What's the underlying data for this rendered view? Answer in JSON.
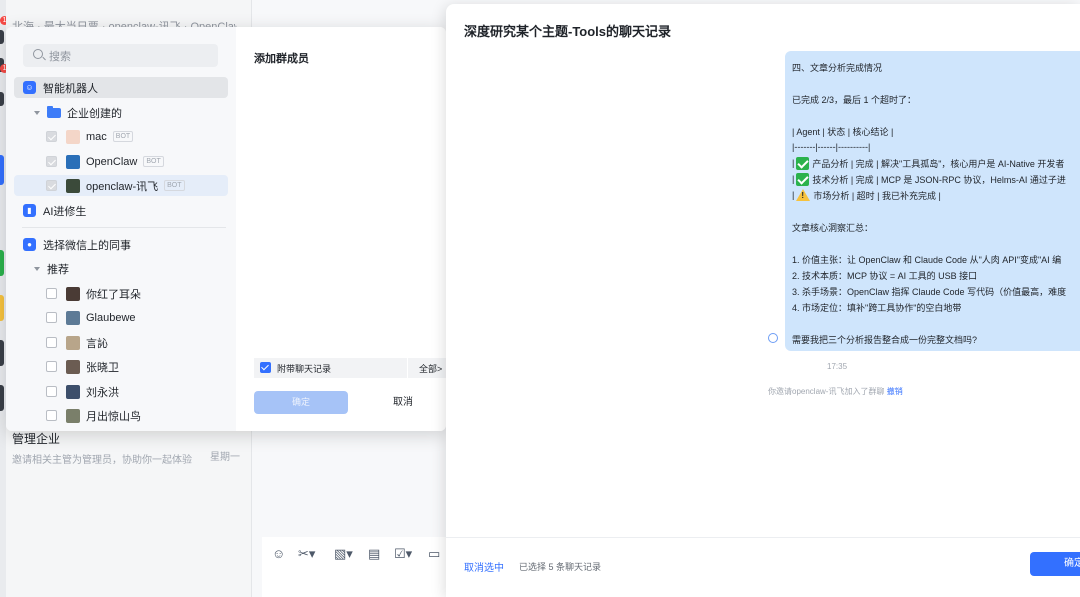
{
  "background": {
    "top_preview": "北海 · 最大当日票 · openclaw-讯飞 · OpenClaw",
    "badges": [
      "1",
      "1"
    ],
    "chat_item": {
      "title": "管理企业",
      "subtitle": "邀请相关主管为管理员，协助你一起体验",
      "date": "星期一"
    },
    "toolbar_icons": [
      "emoji-icon",
      "scissors-icon",
      "image-icon",
      "doc-icon",
      "task-icon",
      "folder-icon"
    ]
  },
  "add_member": {
    "search_placeholder": "搜索",
    "title": "添加群成员",
    "tree": {
      "smart_robot": "智能机器人",
      "enterprise_created": "企业创建的",
      "bots": [
        {
          "name": "mac",
          "tag": "BOT"
        },
        {
          "name": "OpenClaw",
          "tag": "BOT"
        },
        {
          "name": "openclaw-讯飞",
          "tag": "BOT"
        }
      ],
      "ai_section": "AI进修生",
      "wechat_section": "选择微信上的同事",
      "recommend": "推荐",
      "contacts": [
        "你红了耳朵",
        "Glaubewe",
        "言訫",
        "张晓卫",
        "刘永洪",
        "月出惊山鸟"
      ]
    },
    "attach_history": "附带聊天记录",
    "attach_scope": "全部>",
    "confirm": "确定",
    "cancel": "取消"
  },
  "history": {
    "title": "深度研究某个主题-Tools的聊天记录",
    "message": {
      "heading": "四、文章分析完成情况",
      "progress": "已完成 2/3，最后 1 个超时了：",
      "table_header": "| Agent | 状态 | 核心结论 |",
      "table_sep": "|-------|------|----------|",
      "row1": "产品分析 | 完成 | 解决\"工具孤岛\"，核心用户是 AI-Native 开发者",
      "row2": "技术分析 | 完成 | MCP 是 JSON-RPC 协议，Helms-AI 通过子进",
      "row3": "市场分析 | 超时 | 我已补充完成 |",
      "insight_title": "文章核心洞察汇总：",
      "points": [
        "1. 价值主张：让 OpenClaw 和 Claude Code 从\"人肉 API\"变成\"AI 编",
        "2. 技术本质：MCP 协议 = AI 工具的 USB 接口",
        "3. 杀手场景：OpenClaw 指挥 Claude Code 写代码（价值最高，难度",
        "4. 市场定位：填补\"跨工具协作\"的空白地带"
      ],
      "question": "需要我把三个分析报告整合成一份完整文档吗?"
    },
    "time": "17:35",
    "system_msg": "你邀请openclaw-讯飞加入了群聊",
    "system_link": "撤销",
    "cancel_selection": "取消选中",
    "selected_count": "已选择 5 条聊天记录",
    "confirm": "确定"
  },
  "colors": {
    "accent": "#3370ff",
    "bubble": "#cfe5fc",
    "check_emoji": "#2bb24c",
    "warn_emoji": "#f6c23e"
  }
}
